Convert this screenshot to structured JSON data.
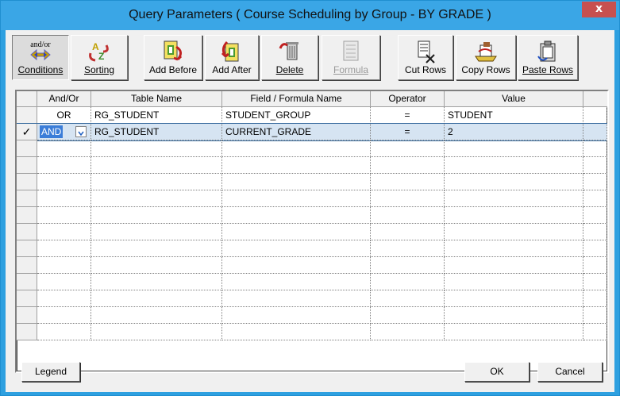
{
  "window": {
    "title": "Query Parameters ( Course Scheduling by Group - BY GRADE )",
    "close_label": "x"
  },
  "toolbar": {
    "buttons": [
      {
        "label": "Conditions",
        "icon": "and-or-icon",
        "icon_text": "and/or",
        "pressed": true
      },
      {
        "label": "Sorting",
        "icon": "sort-az-icon"
      },
      {
        "label": "Add Before",
        "icon": "add-before-icon"
      },
      {
        "label": "Add After",
        "icon": "add-after-icon"
      },
      {
        "label": "Delete",
        "icon": "delete-icon"
      },
      {
        "label": "Formula",
        "icon": "formula-icon",
        "disabled": true
      },
      {
        "label": "Cut Rows",
        "icon": "cut-rows-icon"
      },
      {
        "label": "Copy Rows",
        "icon": "copy-rows-icon"
      },
      {
        "label": "Paste Rows",
        "icon": "paste-rows-icon"
      }
    ]
  },
  "grid": {
    "columns": [
      "And/Or",
      "Table Name",
      "Field / Formula Name",
      "Operator",
      "Value"
    ],
    "rows": [
      {
        "and_or": "OR",
        "table": "RG_STUDENT",
        "field": "STUDENT_GROUP",
        "operator": "=",
        "value": "STUDENT",
        "current": false
      },
      {
        "and_or": "AND",
        "table": "RG_STUDENT",
        "field": "CURRENT_GRADE",
        "operator": "=",
        "value": "2",
        "current": true
      }
    ],
    "current_row_marker": "✓",
    "empty_rows": 12
  },
  "buttons": {
    "legend": "Legend",
    "ok": "OK",
    "cancel": "Cancel"
  },
  "colors": {
    "title_bar": "#3aa6e6",
    "close_button": "#c75050",
    "selection": "#3b7dd8"
  }
}
